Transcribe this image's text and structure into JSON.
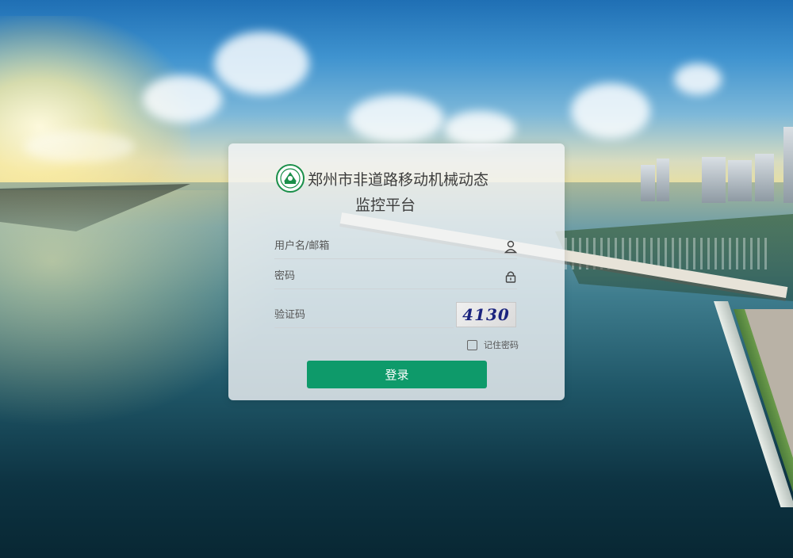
{
  "page": {
    "title_line1": "郑州市非道路移动机械动态",
    "title_line2": "监控平台"
  },
  "login": {
    "username_placeholder": "用户名/邮箱",
    "password_placeholder": "密码",
    "captcha_placeholder": "验证码",
    "captcha_text": "4130",
    "remember_label": "记住密码",
    "submit_label": "登录"
  },
  "colors": {
    "primary": "#0e9a6a",
    "logo_green": "#1b8f4a"
  },
  "icons": {
    "username": "user-icon",
    "password": "lock-icon",
    "logo": "emblem-logo-icon"
  }
}
